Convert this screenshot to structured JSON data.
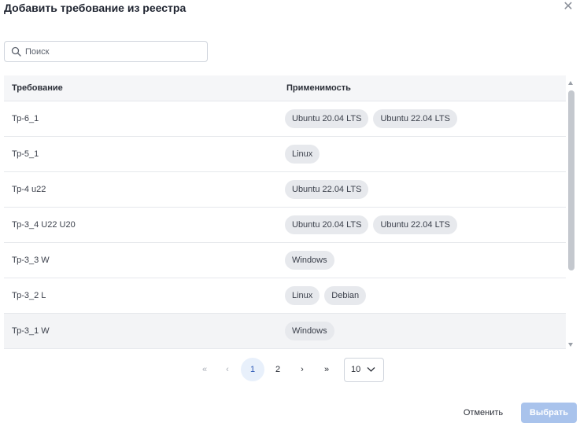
{
  "dialog": {
    "title": "Добавить требование из реестра",
    "close_icon": "close-icon"
  },
  "search": {
    "placeholder": "Поиск",
    "value": "",
    "icon": "search-icon"
  },
  "table": {
    "headers": [
      "Требование",
      "Применимость"
    ],
    "rows": [
      {
        "name": "Тр-6_1",
        "tags": [
          "Ubuntu 20.04 LTS",
          "Ubuntu 22.04 LTS"
        ]
      },
      {
        "name": "Тр-5_1",
        "tags": [
          "Linux"
        ]
      },
      {
        "name": "Тр-4 u22",
        "tags": [
          "Ubuntu 22.04 LTS"
        ]
      },
      {
        "name": "Тр-3_4 U22 U20",
        "tags": [
          "Ubuntu 20.04 LTS",
          "Ubuntu 22.04 LTS"
        ]
      },
      {
        "name": "Тр-3_3 W",
        "tags": [
          "Windows"
        ]
      },
      {
        "name": "Тр-3_2 L",
        "tags": [
          "Linux",
          "Debian"
        ]
      },
      {
        "name": "Тр-3_1 W",
        "tags": [
          "Windows"
        ]
      }
    ]
  },
  "pagination": {
    "first": "«",
    "prev": "‹",
    "pages": [
      "1",
      "2"
    ],
    "current_page": "1",
    "next": "›",
    "last": "»",
    "per_page": "10"
  },
  "footer": {
    "cancel_label": "Отменить",
    "select_label": "Выбрать"
  },
  "colors": {
    "accent": "#2f5bb7",
    "primary_disabled": "#a9c3ec",
    "tag_bg": "#e7e9ed",
    "header_bg": "#f5f6f8"
  }
}
